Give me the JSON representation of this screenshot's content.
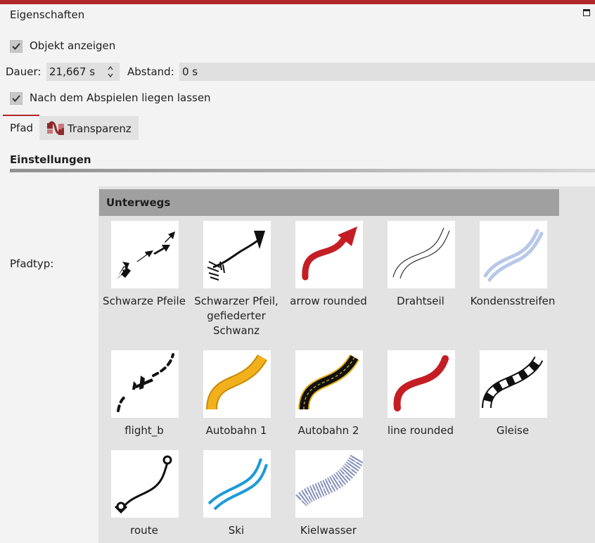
{
  "panel": {
    "title": "Eigenschaften"
  },
  "options": {
    "show_object": {
      "label": "Objekt anzeigen",
      "checked": true
    },
    "dauer_label": "Dauer:",
    "dauer_value": "21,667 s",
    "abstand_label": "Abstand:",
    "abstand_value": "0 s",
    "keep_after_play": {
      "label": "Nach dem Abspielen liegen lassen",
      "checked": true
    }
  },
  "tabs": [
    {
      "label": "Pfad",
      "active": true
    },
    {
      "label": "Transparenz",
      "active": false,
      "icon": "transparency-wave-icon"
    }
  ],
  "settings": {
    "heading": "Einstellungen",
    "pfadtyp_label": "Pfadtyp:"
  },
  "gallery": {
    "group": "Unterwegs",
    "items": [
      {
        "label": "Schwarze Pfeile",
        "icon": "black-arrows-path"
      },
      {
        "label": "Schwarzer Pfeil, gefiederter Schwanz",
        "icon": "feathered-arrow-path"
      },
      {
        "label": "arrow rounded",
        "icon": "red-arrow-rounded-path"
      },
      {
        "label": "Drahtseil",
        "icon": "wire-rope-path"
      },
      {
        "label": "Kondensstreifen",
        "icon": "contrail-path"
      },
      {
        "label": "flight_b",
        "icon": "flight-path"
      },
      {
        "label": "Autobahn 1",
        "icon": "highway-yellow-path"
      },
      {
        "label": "Autobahn 2",
        "icon": "highway-black-path"
      },
      {
        "label": "line rounded",
        "icon": "red-line-rounded-path"
      },
      {
        "label": "Gleise",
        "icon": "rails-path"
      },
      {
        "label": "route",
        "icon": "route-pin-path"
      },
      {
        "label": "Ski",
        "icon": "ski-tracks-path"
      },
      {
        "label": "Kielwasser",
        "icon": "wake-path"
      }
    ]
  },
  "colors": {
    "accent": "#b1272b"
  }
}
